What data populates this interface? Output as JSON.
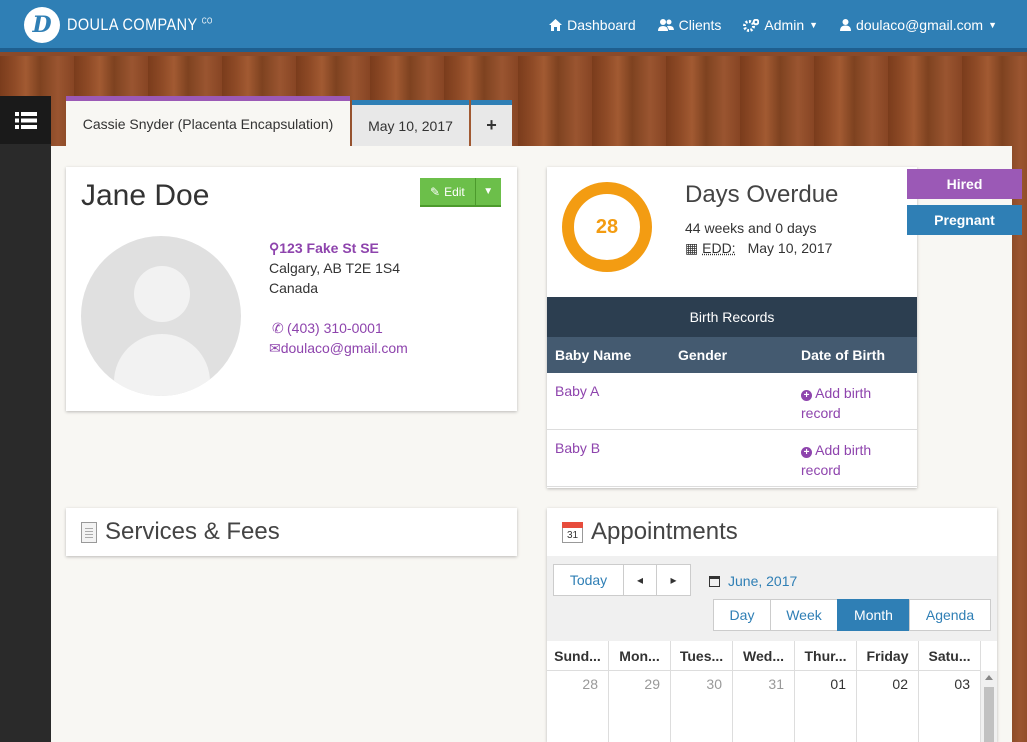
{
  "brand": {
    "logo_letter": "D",
    "name": "DOULA COMPANY",
    "suffix": "CO"
  },
  "nav": {
    "dashboard": "Dashboard",
    "clients": "Clients",
    "admin": "Admin",
    "user": "doulaco@gmail.com"
  },
  "tabs": [
    {
      "label": "Cassie Snyder (Placenta Encapsulation)"
    },
    {
      "label": "May 10, 2017"
    },
    {
      "label": "+"
    }
  ],
  "profile": {
    "name": "Jane Doe",
    "edit_label": "Edit",
    "address": {
      "street": "123 Fake St SE",
      "city_line": "Calgary, AB T2E 1S4",
      "country": "Canada"
    },
    "phone": "(403) 310-0001",
    "email": "doulaco@gmail.com"
  },
  "overdue": {
    "days": "28",
    "title": "Days Overdue",
    "weeks_text": "44 weeks and 0 days",
    "edd_label": "EDD:",
    "edd_date": "May 10, 2017",
    "ring_color": "#f39c12"
  },
  "birth_records": {
    "title": "Birth Records",
    "columns": [
      "Baby Name",
      "Gender",
      "Date of Birth"
    ],
    "rows": [
      {
        "name": "Baby A",
        "gender": "",
        "action": "Add birth record"
      },
      {
        "name": "Baby B",
        "gender": "",
        "action": "Add birth record"
      }
    ]
  },
  "status": {
    "hired": "Hired",
    "pregnant": "Pregnant"
  },
  "services": {
    "title": "Services & Fees"
  },
  "appointments": {
    "title": "Appointments",
    "icon_day": "31",
    "today": "Today",
    "prev": "◂",
    "next": "▸",
    "month": "June, 2017",
    "views": [
      "Day",
      "Week",
      "Month",
      "Agenda"
    ],
    "active_view": "Month",
    "weekdays": [
      "Sund...",
      "Mon...",
      "Tues...",
      "Wed...",
      "Thur...",
      "Friday",
      "Satu..."
    ],
    "days": [
      "28",
      "29",
      "30",
      "31",
      "01",
      "02",
      "03"
    ]
  },
  "colors": {
    "nav": "#2f7fb5",
    "accent_purple": "#8e44ad",
    "edit_green": "#6cbf4a",
    "overdue_orange": "#f39c12"
  }
}
